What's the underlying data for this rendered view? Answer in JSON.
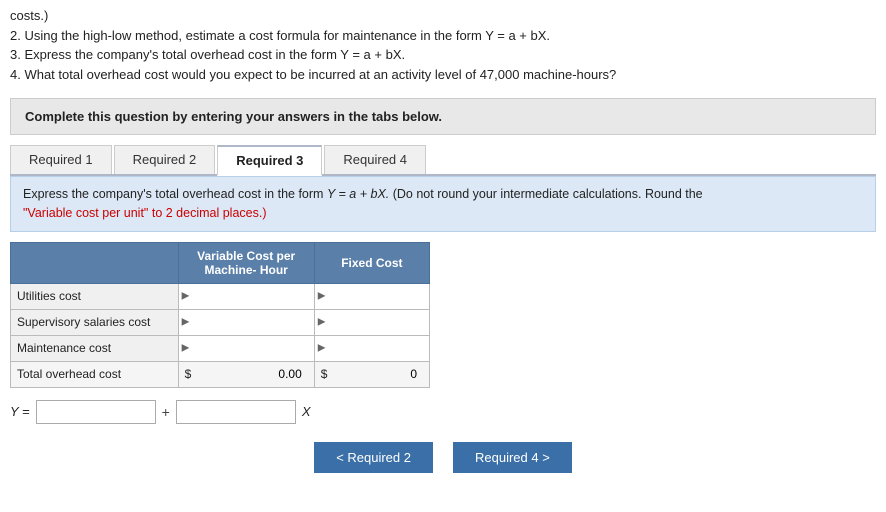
{
  "topText": {
    "line1": "costs.)",
    "line2": "2. Using the high-low method, estimate a cost formula for maintenance in the form Y = a + bX.",
    "line3": "3. Express the company's total overhead cost in the form Y = a + bX.",
    "line4": "4. What total overhead cost would you expect to be incurred at an activity level of 47,000 machine-hours?"
  },
  "instructionBox": {
    "text": "Complete this question by entering your answers in the tabs below."
  },
  "tabs": [
    {
      "label": "Required 1",
      "active": false
    },
    {
      "label": "Required 2",
      "active": false
    },
    {
      "label": "Required 3",
      "active": true
    },
    {
      "label": "Required 4",
      "active": false
    }
  ],
  "infoBanner": {
    "text1": "Express the company's total overhead cost in the form ",
    "formula": "Y = a + bX.",
    "text2": " (Do not round your intermediate calculations. Round the",
    "text3": "\"Variable cost per unit\" to 2 decimal places.)"
  },
  "tableHeaders": {
    "labelCol": "",
    "varCol": "Variable Cost per Machine- Hour",
    "fixedCol": "Fixed Cost"
  },
  "tableRows": [
    {
      "label": "Utilities cost",
      "varValue": "",
      "fixedValue": ""
    },
    {
      "label": "Supervisory salaries cost",
      "varValue": "",
      "fixedValue": ""
    },
    {
      "label": "Maintenance cost",
      "varValue": "",
      "fixedValue": ""
    },
    {
      "label": "Total overhead cost",
      "varSymbol": "$",
      "varValue": "0.00",
      "fixedSymbol": "$",
      "fixedValue": "0"
    }
  ],
  "formulaRow": {
    "label": "Y =",
    "plus": "+",
    "xLabel": "X"
  },
  "bottomNav": {
    "prevBtn": "< Required 2",
    "nextBtn": "Required 4 >"
  }
}
